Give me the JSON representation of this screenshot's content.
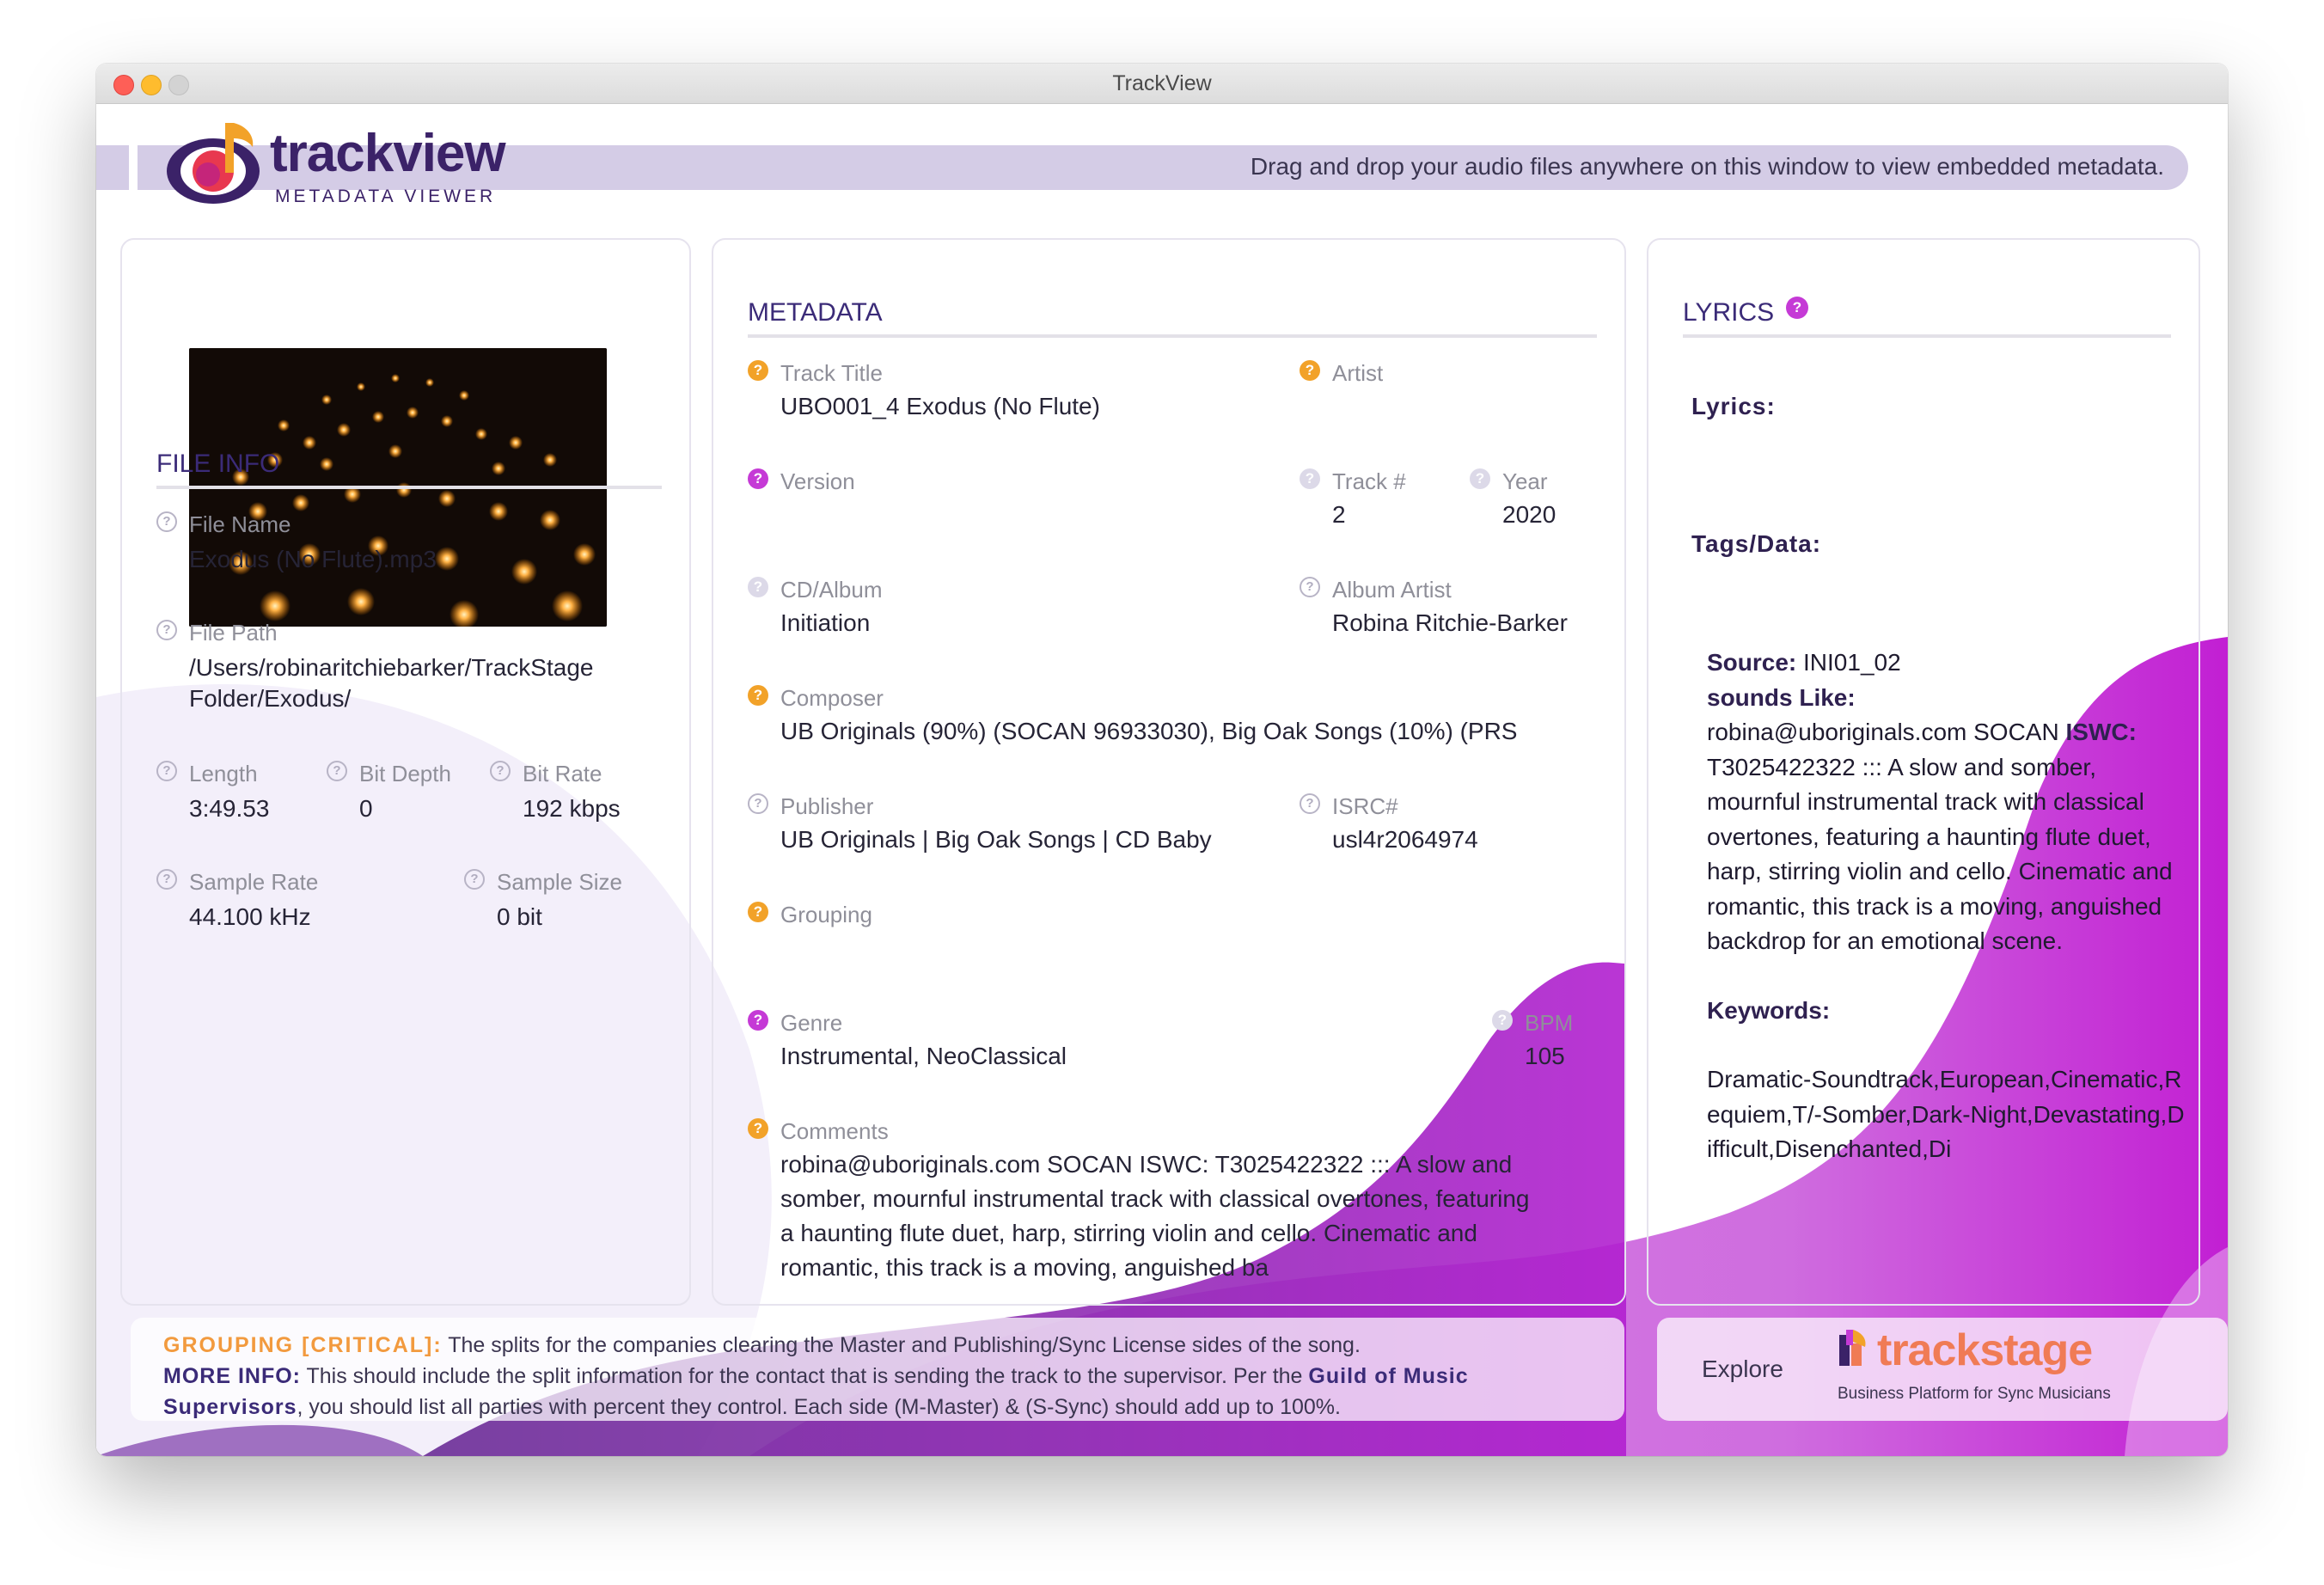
{
  "window": {
    "title": "TrackView"
  },
  "header": {
    "brand_name": "trackview",
    "brand_sub": "METADATA VIEWER",
    "message": "Drag and drop your audio files anywhere on this window to view embedded metadata."
  },
  "file_info": {
    "title": "FILE INFO",
    "file_name_label": "File Name",
    "file_name": "Exodus (No Flute).mp3",
    "file_path_label": "File Path",
    "file_path_line1": "/Users/robinaritchiebarker/TrackStage",
    "file_path_line2": "Folder/Exodus/",
    "length_label": "Length",
    "length": "3:49.53",
    "bit_depth_label": "Bit Depth",
    "bit_depth": "0",
    "bit_rate_label": "Bit Rate",
    "bit_rate": "192 kbps",
    "sample_rate_label": "Sample Rate",
    "sample_rate": "44.100 kHz",
    "sample_size_label": "Sample Size",
    "sample_size": "0 bit"
  },
  "metadata": {
    "title": "METADATA",
    "track_title_label": "Track Title",
    "track_title": "UBO001_4 Exodus (No Flute)",
    "artist_label": "Artist",
    "artist": "",
    "version_label": "Version",
    "version": "",
    "track_num_label": "Track #",
    "track_num": "2",
    "year_label": "Year",
    "year": "2020",
    "album_label": "CD/Album",
    "album": "Initiation",
    "album_artist_label": "Album Artist",
    "album_artist": "Robina Ritchie-Barker",
    "composer_label": "Composer",
    "composer": "UB Originals (90%) (SOCAN 96933030), Big Oak Songs (10%) (PRS",
    "publisher_label": "Publisher",
    "publisher": "UB Originals | Big Oak Songs | CD Baby",
    "isrc_label": "ISRC#",
    "isrc": "usl4r2064974",
    "grouping_label": "Grouping",
    "grouping": "",
    "genre_label": "Genre",
    "genre": "Instrumental, NeoClassical",
    "bpm_label": "BPM",
    "bpm": "105",
    "comments_label": "Comments",
    "comments_line1": "robina@uboriginals.com SOCAN ISWC: T3025422322 ::: A slow and",
    "comments_line2": "somber, mournful instrumental track with classical overtones, featuring",
    "comments_line3": "a haunting flute duet, harp, stirring violin and cello. Cinematic and",
    "comments_line4": "romantic, this track is a moving, anguished ba"
  },
  "lyrics": {
    "title": "LYRICS",
    "lyrics_label": "Lyrics:",
    "tags_label": "Tags/Data:",
    "source_label": "Source:",
    "source_value": " INI01_02",
    "sounds_like_label": "sounds Like:",
    "sounds_like_text": "robina@uboriginals.com SOCAN ",
    "iswc_label": "ISWC:",
    "iswc_text": "T3025422322 ::: A slow and somber, mournful instrumental track with classical overtones, featuring a haunting flute duet, harp, stirring violin and cello. Cinematic and romantic, this track is a moving, anguished backdrop for an emotional scene.",
    "keywords_label": "Keywords:",
    "keywords_text": "Dramatic-Soundtrack,European,Cinematic,Requiem,T/-Somber,Dark-Night,Devastating,Difficult,Disenchanted,Di"
  },
  "footer": {
    "grouping_label": "GROUPING [CRITICAL]:",
    "grouping_text": "  The splits for the companies clearing the Master and Publishing/Sync License sides of the song.",
    "more_info_label": "MORE INFO:",
    "more_info_text1": " This should include the split information for the contact that is sending the track to the supervisor. Per the ",
    "guild": "Guild of Music Supervisors",
    "more_info_text2": ", you should list all parties with percent they control. Each side (M-Master) & (S-Sync) should add up to 100%.",
    "explore": "Explore",
    "trackstage_brand": "trackstage",
    "trackstage_sub": "Business Platform for Sync Musicians"
  },
  "colors": {
    "accent_purple": "#3b2b78",
    "orange": "#f2a229",
    "magenta": "#c53ad6",
    "band": "#d4cce6"
  }
}
